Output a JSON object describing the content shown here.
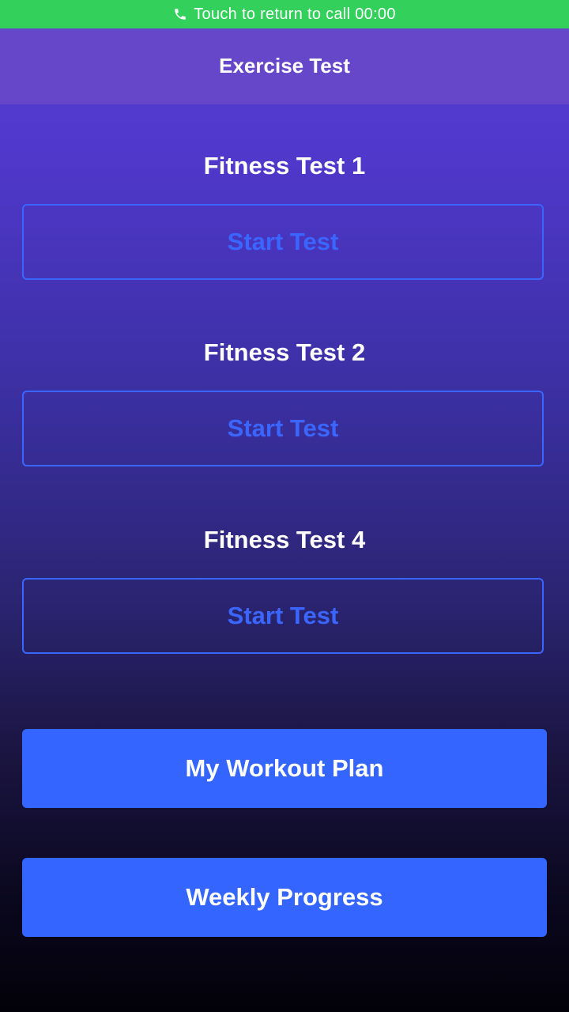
{
  "call_bar": {
    "text": "Touch to return to call 00:00",
    "color": "#33d15c",
    "icon": "phone-icon"
  },
  "nav": {
    "title": "Exercise Test",
    "color": "#6647c9"
  },
  "tests": [
    {
      "title": "Fitness Test 1",
      "button_label": "Start Test"
    },
    {
      "title": "Fitness Test 2",
      "button_label": "Start Test"
    },
    {
      "title": "Fitness Test 4",
      "button_label": "Start Test"
    }
  ],
  "actions": {
    "workout_plan_label": "My Workout Plan",
    "weekly_progress_label": "Weekly Progress"
  },
  "colors": {
    "accent": "#3565ff",
    "outline": "#3a66ff"
  }
}
